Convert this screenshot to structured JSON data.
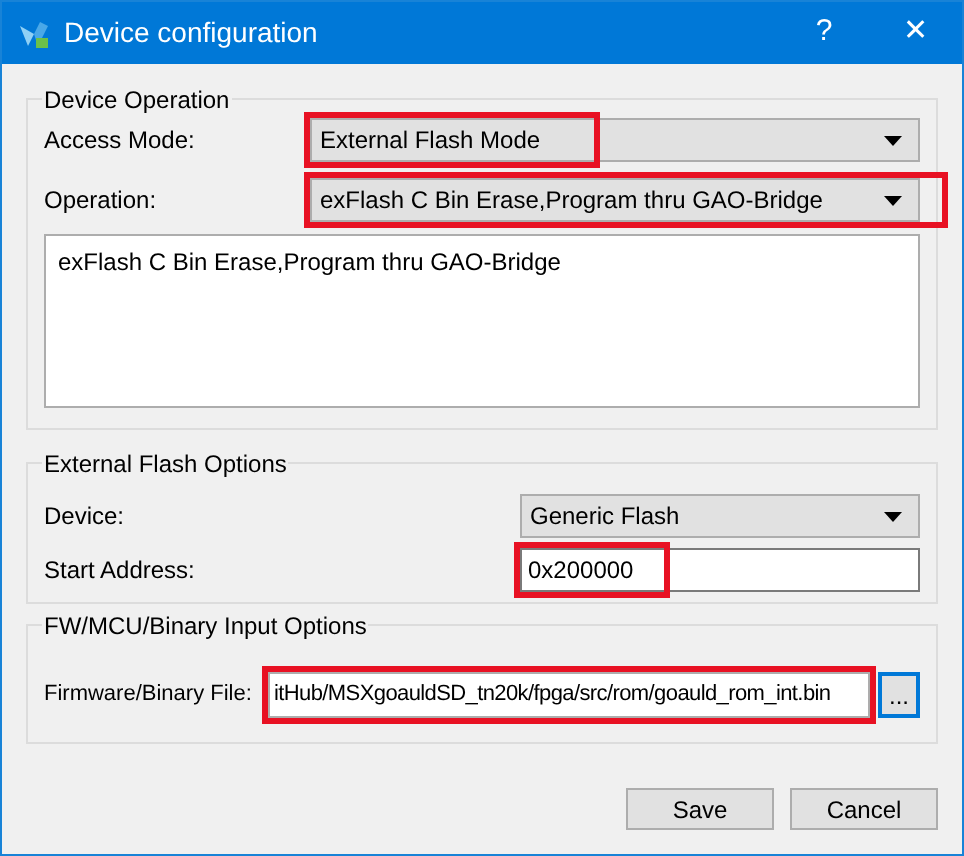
{
  "window": {
    "title": "Device configuration",
    "help": "?",
    "close": "✕"
  },
  "device_operation": {
    "title": "Device Operation",
    "fields": [
      {
        "label": "Access Mode:",
        "value": "External Flash Mode",
        "kind": "combo",
        "highlighted": true
      },
      {
        "label": "Operation:",
        "value": "exFlash C Bin Erase,Program thru GAO-Bridge",
        "kind": "combo",
        "highlighted": true
      }
    ],
    "description": "exFlash C Bin Erase,Program thru GAO-Bridge"
  },
  "external_flash_options": {
    "title": "External Flash Options",
    "fields": [
      {
        "label": "Device:",
        "value": "Generic Flash",
        "kind": "combo",
        "highlighted": false
      },
      {
        "label": "Start Address:",
        "value": "0x200000",
        "kind": "text",
        "highlighted": true
      }
    ]
  },
  "binary_input_options": {
    "title": "FW/MCU/Binary Input Options",
    "label": "Firmware/Binary File:",
    "value": "itHub/MSXgoauldSD_tn20k/fpga/src/rom/goauld_rom_int.bin",
    "highlighted": true,
    "browse": "..."
  },
  "buttons": [
    "Save",
    "Cancel"
  ]
}
